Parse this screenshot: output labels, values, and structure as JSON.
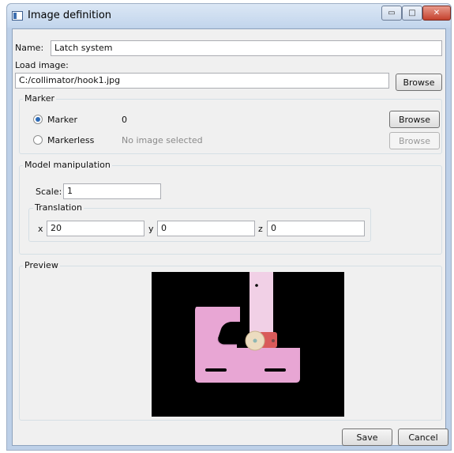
{
  "window": {
    "title": "Image definition"
  },
  "form": {
    "name_label": "Name:",
    "name_value": "Latch system",
    "load_image_label": "Load image:",
    "image_path": "C:/collimator/hook1.jpg",
    "browse_label": "Browse"
  },
  "marker_group": {
    "title": "Marker",
    "options": [
      {
        "label": "Marker",
        "value": "0",
        "checked": true,
        "button": "Browse",
        "enabled": true
      },
      {
        "label": "Markerless",
        "value": "No image selected",
        "checked": false,
        "button": "Browse",
        "enabled": false
      }
    ]
  },
  "model_group": {
    "title": "Model manipulation",
    "scale_label": "Scale:",
    "scale_value": "1",
    "translation": {
      "title": "Translation",
      "x_label": "x",
      "x_value": "20",
      "y_label": "y",
      "y_value": "0",
      "z_label": "z",
      "z_value": "0"
    }
  },
  "preview": {
    "title": "Preview"
  },
  "footer": {
    "save_label": "Save",
    "cancel_label": "Cancel"
  },
  "colors": {
    "preview_bg": "#000000",
    "part_pink": "#e8a6d4",
    "rod_pink": "#f1d0e6",
    "disc": "#ecdcc0",
    "red_block": "#d95a5a"
  }
}
